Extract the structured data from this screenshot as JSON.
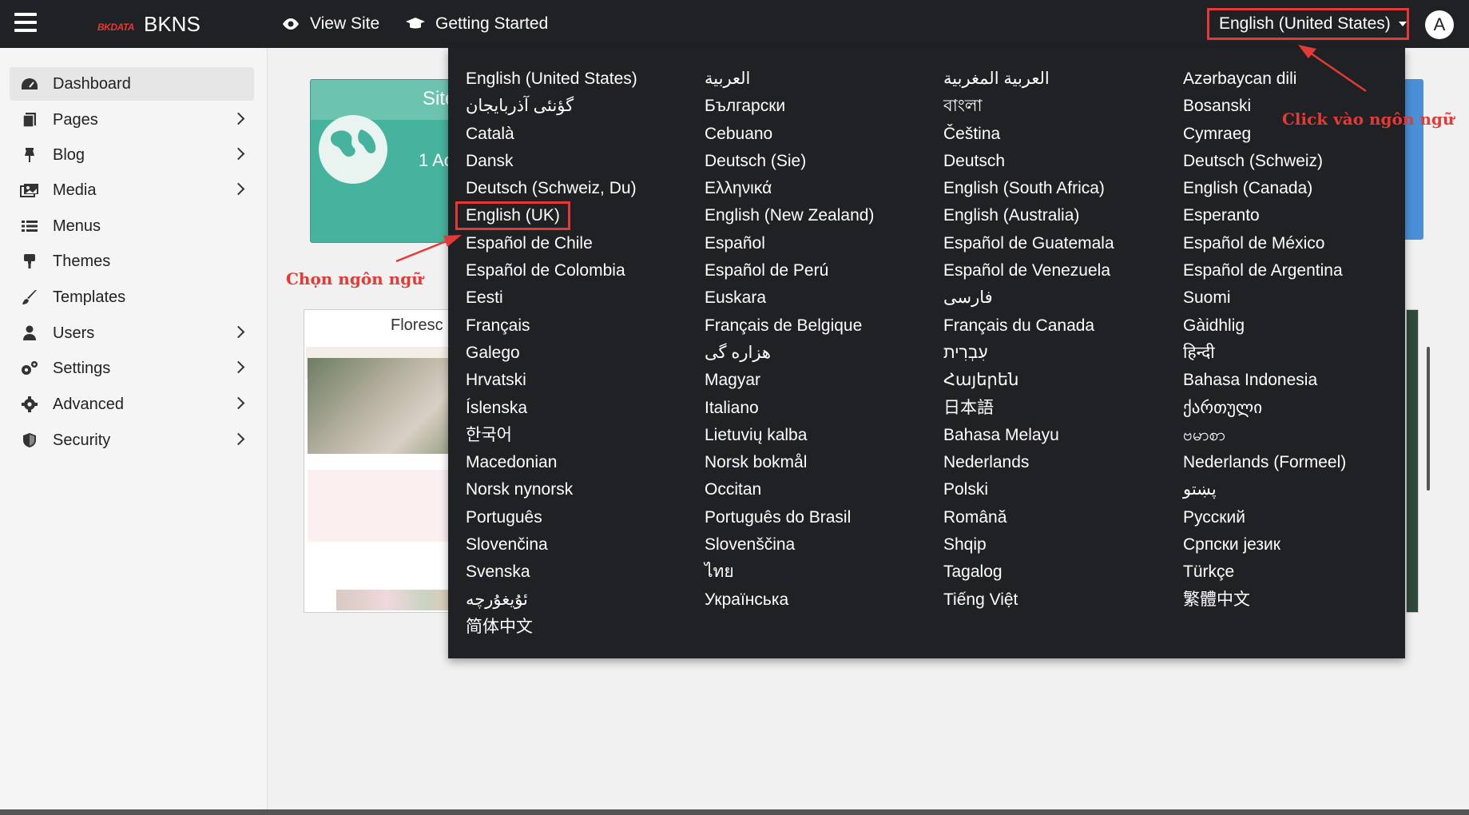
{
  "header": {
    "logo_text": "BKDATA",
    "brand": "BKNS",
    "nav": [
      {
        "label": "View Site",
        "icon": "eye-icon"
      },
      {
        "label": "Getting Started",
        "icon": "graduation-cap-icon"
      }
    ],
    "language_button": "English (United States)",
    "avatar_letter": "A"
  },
  "sidebar": {
    "items": [
      {
        "label": "Dashboard",
        "icon": "dashboard-icon",
        "has_children": false,
        "active": true
      },
      {
        "label": "Pages",
        "icon": "pages-icon",
        "has_children": true
      },
      {
        "label": "Blog",
        "icon": "pin-icon",
        "has_children": true
      },
      {
        "label": "Media",
        "icon": "media-icon",
        "has_children": true
      },
      {
        "label": "Menus",
        "icon": "menu-list-icon",
        "has_children": false
      },
      {
        "label": "Themes",
        "icon": "paint-roller-icon",
        "has_children": false
      },
      {
        "label": "Templates",
        "icon": "brush-icon",
        "has_children": false
      },
      {
        "label": "Users",
        "icon": "user-icon",
        "has_children": true
      },
      {
        "label": "Settings",
        "icon": "cogs-icon",
        "has_children": true
      },
      {
        "label": "Advanced",
        "icon": "gear-icon",
        "has_children": true
      },
      {
        "label": "Security",
        "icon": "shield-icon",
        "has_children": true
      }
    ]
  },
  "main": {
    "site_card": {
      "title": "Site",
      "count_text": "1 Ac"
    },
    "theme_card": {
      "title": "Floresc"
    }
  },
  "language_menu": {
    "selected": "English (UK)",
    "columns": [
      [
        "English (United States)",
        "گؤنئی آذربایجان",
        "Català",
        "Dansk",
        "Deutsch (Schweiz, Du)",
        "English (UK)",
        "Español de Chile",
        "Español de Colombia",
        "Eesti",
        "Français",
        "Galego",
        "Hrvatski",
        "Íslenska",
        "한국어",
        "Macedonian",
        "Norsk nynorsk",
        "Português",
        "Slovenčina",
        "Svenska",
        "ئۇيغۇرچە",
        "简体中文"
      ],
      [
        "العربية",
        "Български",
        "Cebuano",
        "Deutsch (Sie)",
        "Ελληνικά",
        "English (New Zealand)",
        "Español",
        "Español de Perú",
        "Euskara",
        "Français de Belgique",
        "هزاره گی",
        "Magyar",
        "Italiano",
        "Lietuvių kalba",
        "Norsk bokmål",
        "Occitan",
        "Português do Brasil",
        "Slovenščina",
        "ไทย",
        "Українська"
      ],
      [
        "العربية المغربية",
        "বাংলা",
        "Čeština",
        "Deutsch",
        "English (South Africa)",
        "English (Australia)",
        "Español de Guatemala",
        "Español de Venezuela",
        "فارسی",
        "Français du Canada",
        "עִבְרִית",
        "Հայերեն",
        "日本語",
        "Bahasa Melayu",
        "Nederlands",
        "Polski",
        "Română",
        "Shqip",
        "Tagalog",
        "Tiếng Việt"
      ],
      [
        "Azərbaycan dili",
        "Bosanski",
        "Cymraeg",
        "Deutsch (Schweiz)",
        "English (Canada)",
        "Esperanto",
        "Español de México",
        "Español de Argentina",
        "Suomi",
        "Gàidhlig",
        "हिन्दी",
        "Bahasa Indonesia",
        "ქართული",
        "ဗမာစာ",
        "Nederlands (Formeel)",
        "پښتو",
        "Русский",
        "Српски језик",
        "Türkçe",
        "繁體中文"
      ]
    ]
  },
  "annotations": {
    "click_language": "Click vào ngôn ngữ",
    "choose_language": "Chọn ngôn ngữ"
  },
  "colors": {
    "topbar": "#202124",
    "dropdown": "#202124",
    "annotation": "#e53935",
    "accent_green": "#45b39d"
  }
}
